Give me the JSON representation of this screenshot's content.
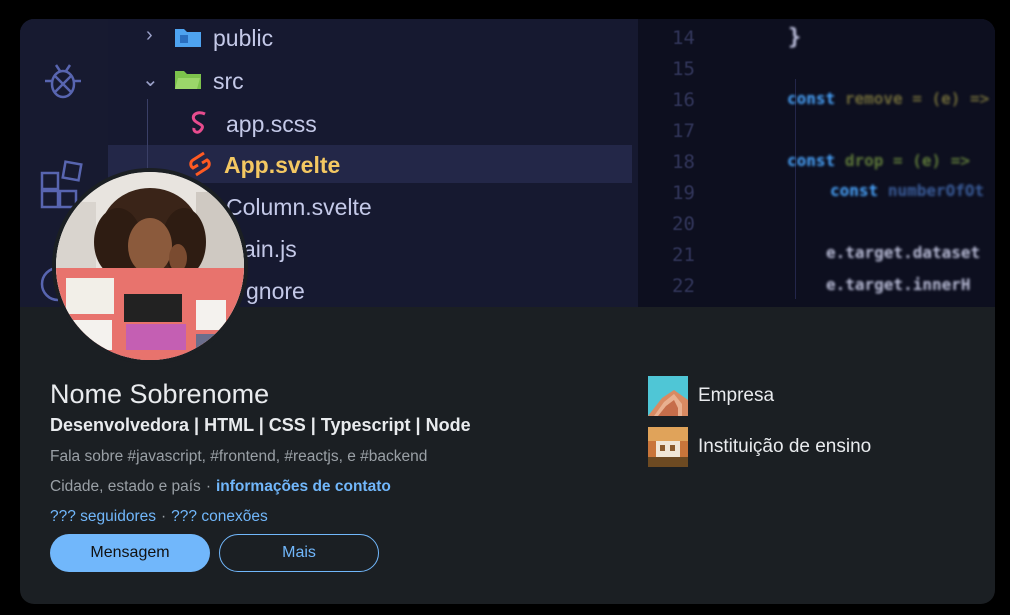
{
  "banner": {
    "tree": {
      "public": "public",
      "src": "src",
      "scss": "app.scss",
      "svelte": "App.svelte",
      "column": "Column.svelte",
      "main": "ain.js",
      "ignore": "gnore"
    },
    "line_numbers": [
      "14",
      "15",
      "16",
      "17",
      "18",
      "19",
      "20",
      "21",
      "22"
    ],
    "code": {
      "brace": "}",
      "l1_kw": "const",
      "l1_rest": "remove = (e) =>",
      "l2_kw": "const",
      "l2_rest": "drop = (e) =>",
      "l3_kw": "const",
      "l3_rest": "numberOfOt",
      "l4": "e.target.dataset",
      "l5": "e.target.innerH"
    }
  },
  "profile": {
    "name": "Nome Sobrenome",
    "headline": "Desenvolvedora | HTML | CSS | Typescript | Node",
    "about": "Fala sobre #javascript, #frontend, #reactjs, e #backend",
    "location": "Cidade, estado e país",
    "separator": "·",
    "contact_link": "informações de contato",
    "followers": "??? seguidores",
    "connections": "??? conexões"
  },
  "actions": {
    "message": "Mensagem",
    "more": "Mais"
  },
  "experience": [
    {
      "label": "Empresa",
      "icon": "company-logo"
    },
    {
      "label": "Instituição de ensino",
      "icon": "school-logo"
    }
  ],
  "colors": {
    "card": "#1b1f23",
    "accent": "#71b7fb",
    "text": "#e9ebee",
    "muted": "#9aa0a6"
  }
}
